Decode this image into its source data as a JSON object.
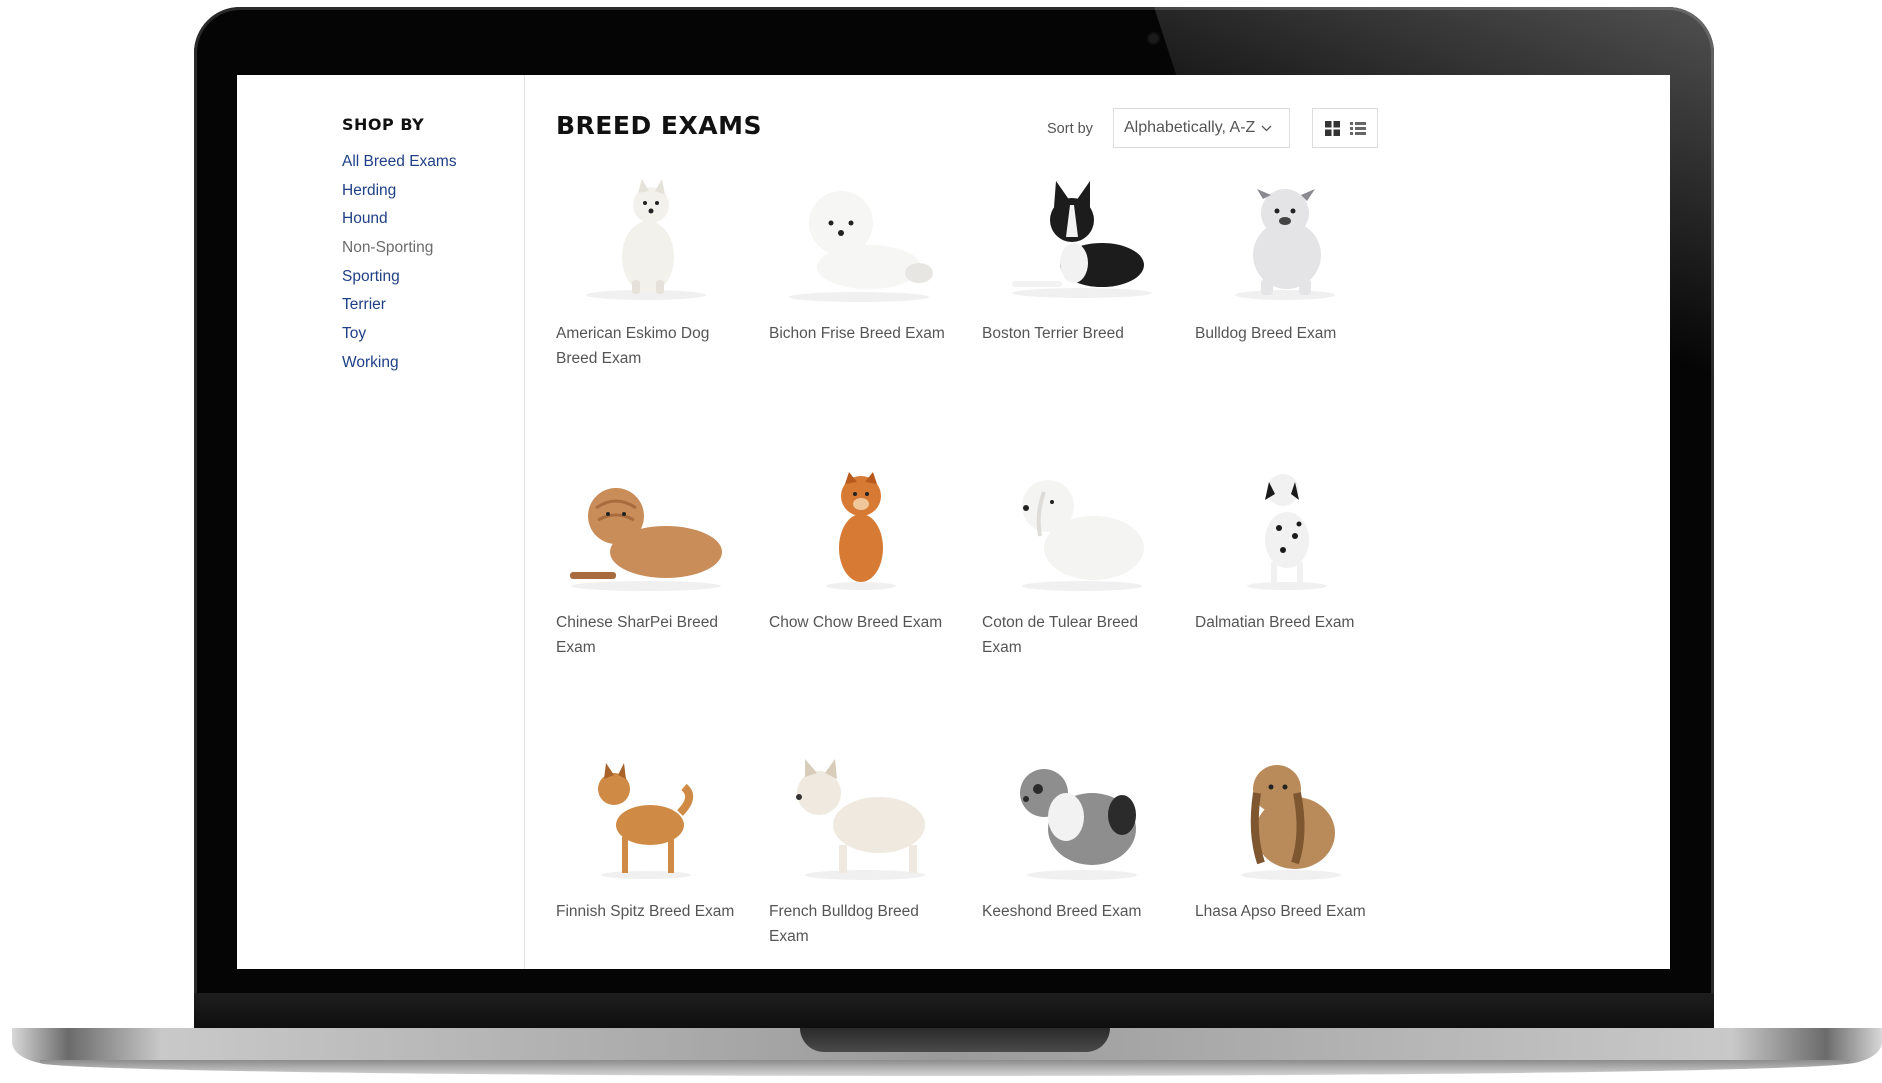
{
  "sidebar": {
    "title": "SHOP BY",
    "items": [
      {
        "label": "All Breed Exams"
      },
      {
        "label": "Herding"
      },
      {
        "label": "Hound"
      },
      {
        "label": "Non-Sporting"
      },
      {
        "label": "Sporting"
      },
      {
        "label": "Terrier"
      },
      {
        "label": "Toy"
      },
      {
        "label": "Working"
      }
    ]
  },
  "collection": {
    "title": "BREED EXAMS",
    "sort_label": "Sort by",
    "sort_value": "Alphabetically, A-Z"
  },
  "products": [
    {
      "title": "American Eskimo Dog Breed Exam",
      "icon": "american-eskimo-dog-photo",
      "fur": "#f3f1ec",
      "accent": "#e6e2da"
    },
    {
      "title": "Bichon Frise Breed Exam",
      "icon": "bichon-frise-photo",
      "fur": "#f6f6f4",
      "accent": "#e8e6e2"
    },
    {
      "title": "Boston Terrier Breed",
      "icon": "boston-terrier-photo",
      "fur": "#1c1c1c",
      "accent": "#f2f2f2"
    },
    {
      "title": "Bulldog Breed Exam",
      "icon": "bulldog-photo",
      "fur": "#e4e4e6",
      "accent": "#8a8a90"
    },
    {
      "title": "Chinese SharPei Breed Exam",
      "icon": "chinese-sharpei-photo",
      "fur": "#c98d5a",
      "accent": "#a86b3d"
    },
    {
      "title": "Chow Chow Breed Exam",
      "icon": "chow-chow-photo",
      "fur": "#d77a34",
      "accent": "#b85a1e"
    },
    {
      "title": "Coton de Tulear Breed Exam",
      "icon": "coton-de-tulear-photo",
      "fur": "#f4f4f2",
      "accent": "#dedcd8"
    },
    {
      "title": "Dalmatian Breed Exam",
      "icon": "dalmatian-photo",
      "fur": "#f1f1f1",
      "accent": "#1a1a1a"
    },
    {
      "title": "Finnish Spitz Breed Exam",
      "icon": "finnish-spitz-photo",
      "fur": "#cf8a45",
      "accent": "#a8632a"
    },
    {
      "title": "French Bulldog Breed Exam",
      "icon": "french-bulldog-photo",
      "fur": "#efe9df",
      "accent": "#d8ccba"
    },
    {
      "title": "Keeshond Breed Exam",
      "icon": "keeshond-photo",
      "fur": "#8e8e8e",
      "accent": "#2b2b2b"
    },
    {
      "title": "Lhasa Apso Breed Exam",
      "icon": "lhasa-apso-photo",
      "fur": "#b98a5a",
      "accent": "#7e5630"
    }
  ]
}
